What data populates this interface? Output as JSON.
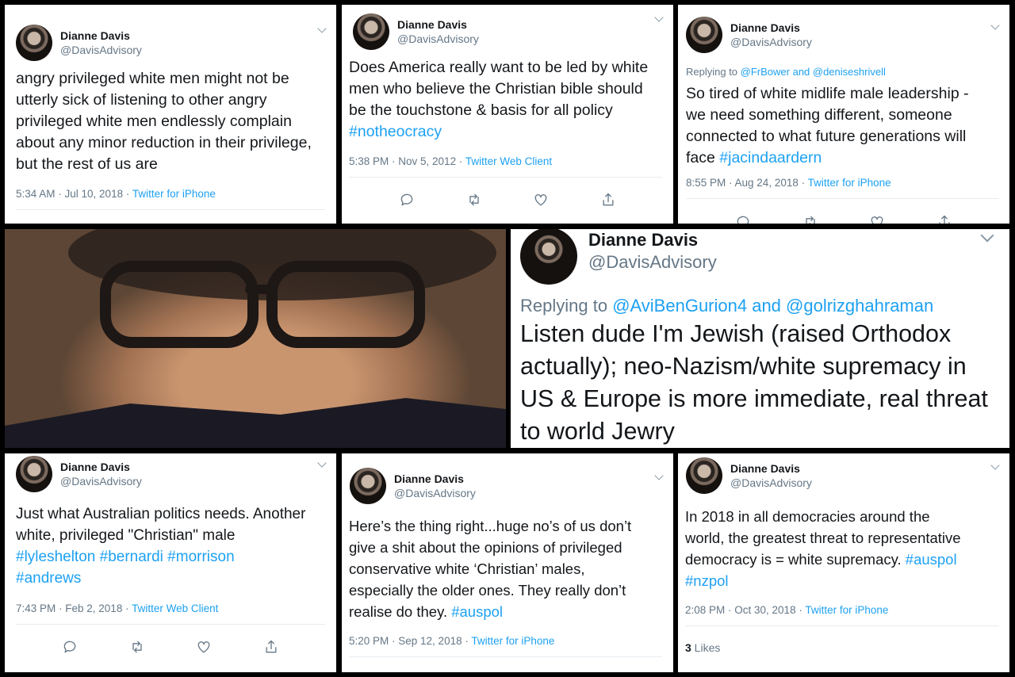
{
  "tweets": {
    "t1": {
      "name": "Dianne Davis",
      "handle": "@DavisAdvisory",
      "lines": [
        "angry privileged white men might not be",
        "utterly sick of listening to other angry",
        "privileged white men endlessly complain",
        "about any minor reduction in their privilege,",
        "but the rest of us are"
      ],
      "time": "5:34 AM · Jul 10, 2018 · ",
      "client": "Twitter for iPhone"
    },
    "t2": {
      "name": "Dianne Davis",
      "handle": "@DavisAdvisory",
      "lines": [
        "Does America really want to be led by white",
        "men who believe the Christian bible should",
        "be the touchstone & basis for all policy"
      ],
      "hashtag": "#notheocracy",
      "time": "5:38 PM · Nov 5, 2012 · ",
      "client": "Twitter Web Client"
    },
    "t3": {
      "name": "Dianne Davis",
      "handle": "@DavisAdvisory",
      "reply_prefix": "Replying to ",
      "reply_to": "@FrBower and @deniseshrivell",
      "lines": [
        "So tired of white midlife male leadership -",
        "we need something different, someone",
        "connected to what future generations will"
      ],
      "last_line_prefix": "face ",
      "hashtag": "#jacindaardern",
      "time": "8:55 PM · Aug 24, 2018 · ",
      "client": "Twitter for iPhone"
    },
    "t4": {
      "name": "Dianne Davis",
      "handle": "@DavisAdvisory",
      "reply_prefix": "Replying to ",
      "reply_to": "@AviBenGurion4 and @golrizghahraman",
      "lines": [
        "Listen dude I'm Jewish (raised Orthodox",
        "actually); neo-Nazism/white supremacy in",
        "US & Europe is more immediate, real threat",
        "to world Jewry"
      ]
    },
    "t5": {
      "name": "Dianne Davis",
      "handle": "@DavisAdvisory",
      "lines": [
        "Just what Australian politics needs. Another",
        "white, privileged \"Christian\" male"
      ],
      "hashtags1": "#lyleshelton #bernardi #morrison",
      "hashtags2": "#andrews",
      "time": "7:43 PM · Feb 2, 2018 · ",
      "client": "Twitter Web Client"
    },
    "t6": {
      "name": "Dianne Davis",
      "handle": "@DavisAdvisory",
      "lines": [
        "Here’s the thing right...huge no’s of us don’t",
        "give a shit about the opinions of privileged",
        "conservative white ‘Christian’ males,",
        "especially the older ones. They really don’t"
      ],
      "last_line_prefix": "realise do they.  ",
      "hashtag": "#auspol",
      "time": "5:20 PM · Sep 12, 2018 · ",
      "client": "Twitter for iPhone"
    },
    "t7": {
      "name": "Dianne Davis",
      "handle": "@DavisAdvisory",
      "lines": [
        "In 2018 in all democracies around the",
        "world, the greatest threat to representative"
      ],
      "line3_prefix": "democracy is = white supremacy. ",
      "hashtag1": "#auspol",
      "hashtag2": "#nzpol",
      "time": "2:08 PM · Oct 30, 2018 · ",
      "client": "Twitter for iPhone",
      "likes_count": "3",
      "likes_label": " Likes"
    }
  },
  "icons": [
    "reply-icon",
    "retweet-icon",
    "like-icon",
    "share-icon",
    "chevron-down-icon"
  ]
}
